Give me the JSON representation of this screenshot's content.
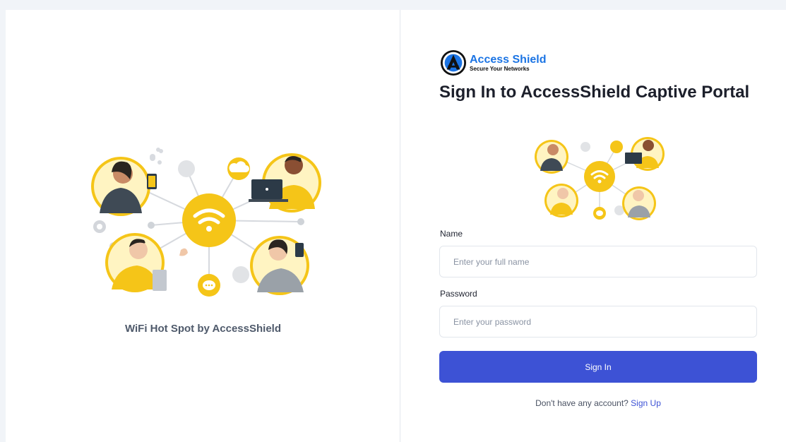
{
  "left_panel": {
    "caption": "WiFi Hot Spot by AccessShield"
  },
  "brand": {
    "name": "Access Shield",
    "tagline": "Secure Your Networks"
  },
  "form": {
    "title": "Sign In to AccessShield Captive Portal",
    "name_label": "Name",
    "name_placeholder": "Enter your full name",
    "name_value": "",
    "password_label": "Password",
    "password_placeholder": "Enter your password",
    "password_value": "",
    "submit_label": "Sign In",
    "signup_prompt": "Don't have any account?",
    "signup_link": "Sign Up"
  },
  "colors": {
    "accent": "#3d52d5",
    "brand_blue": "#1b74e4",
    "illustration_yellow": "#f5c518",
    "background": "#f1f4f8"
  },
  "icons": [
    "access-shield-logo",
    "wifi-icon",
    "cloud-icon",
    "chat-bubble-icon",
    "gear-icon",
    "share-icon",
    "laptop-icon",
    "phone-icon"
  ]
}
